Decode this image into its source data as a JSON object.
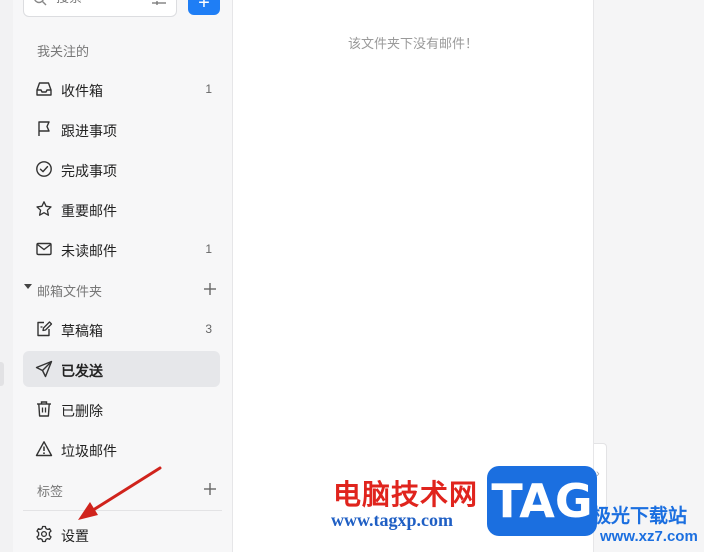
{
  "search": {
    "placeholder": "搜索"
  },
  "compose": {
    "label": "+"
  },
  "sections": {
    "following": "我关注的",
    "folders": "邮箱文件夹",
    "tags": "标签"
  },
  "items": [
    {
      "label": "收件箱",
      "count": "1",
      "icon": "inbox-icon"
    },
    {
      "label": "跟进事项",
      "count": "",
      "icon": "flag-icon"
    },
    {
      "label": "完成事项",
      "count": "",
      "icon": "check-circle-icon"
    },
    {
      "label": "重要邮件",
      "count": "",
      "icon": "star-icon"
    },
    {
      "label": "未读邮件",
      "count": "1",
      "icon": "envelope-icon"
    },
    {
      "label": "草稿箱",
      "count": "3",
      "icon": "draft-icon"
    },
    {
      "label": "已发送",
      "count": "",
      "icon": "send-icon",
      "active": true
    },
    {
      "label": "已删除",
      "count": "",
      "icon": "trash-icon"
    },
    {
      "label": "垃圾邮件",
      "count": "",
      "icon": "warning-icon"
    }
  ],
  "settings": {
    "label": "设置",
    "icon": "gear-icon"
  },
  "main": {
    "empty_message": "该文件夹下没有邮件！"
  },
  "watermark": {
    "title": "电脑技术网",
    "url": "www.tagxp.com",
    "logo": "TAG",
    "site": "极光下载站",
    "domain": "www.xz7.com"
  },
  "colors": {
    "accent": "#1f7ef5",
    "active_bg": "#e6e7ea",
    "sidebar_bg": "#f7f7f8",
    "arrow": "#d0231c"
  }
}
